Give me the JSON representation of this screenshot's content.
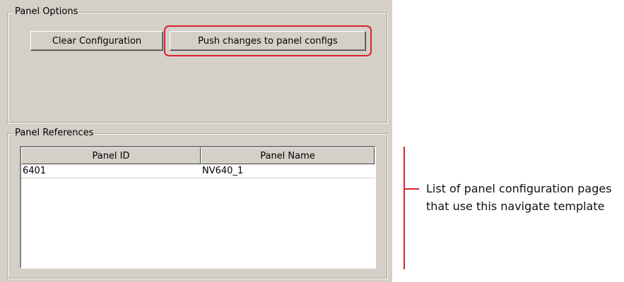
{
  "panel_options": {
    "title": "Panel Options",
    "clear_button": "Clear Configuration",
    "push_button": "Push changes to panel configs"
  },
  "panel_references": {
    "title": "Panel References",
    "columns": [
      "Panel ID",
      "Panel Name"
    ],
    "rows": [
      {
        "panel_id": "6401",
        "panel_name": "NV640_1"
      }
    ]
  },
  "annotation": {
    "text": "List of panel configuration pages that use this navigate template",
    "color": "#d8232a"
  },
  "colors": {
    "dialog_background": "#d4d0c8",
    "highlight": "#d8232a"
  }
}
